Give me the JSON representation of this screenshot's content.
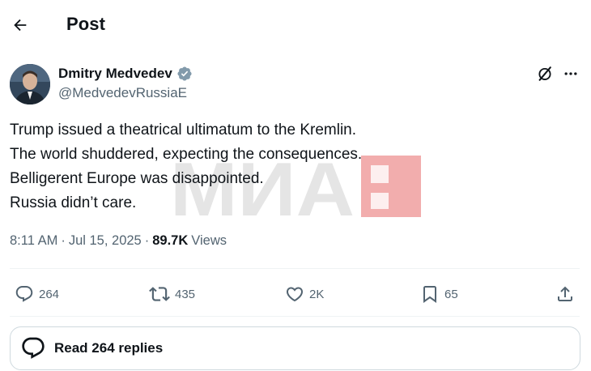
{
  "header": {
    "title": "Post"
  },
  "author": {
    "name": "Dmitry Medvedev",
    "handle": "@MedvedevRussiaE",
    "verified_color": "#829aab"
  },
  "tweet": {
    "lines": [
      "Trump issued a theatrical ultimatum to the Kremlin.",
      "The world shuddered, expecting the consequences.",
      "Belligerent Europe was disappointed.",
      "Russia didn’t care."
    ]
  },
  "watermark": {
    "text": "МИА",
    "color": "#e24a4a"
  },
  "meta": {
    "time": "8:11 AM",
    "separator": "·",
    "date": "Jul 15, 2025",
    "views_count": "89.7K",
    "views_label": "Views"
  },
  "actions": {
    "replies": "264",
    "reposts": "435",
    "likes": "2K",
    "bookmarks": "65"
  },
  "read_replies": {
    "label": "Read 264 replies"
  },
  "icons": {
    "back": "arrow-left-icon",
    "grok": "grok-icon",
    "more": "more-horizontal-icon",
    "reply": "reply-icon",
    "repost": "repost-icon",
    "like": "heart-icon",
    "bookmark": "bookmark-icon",
    "share": "share-icon",
    "verified": "verified-badge-icon"
  }
}
